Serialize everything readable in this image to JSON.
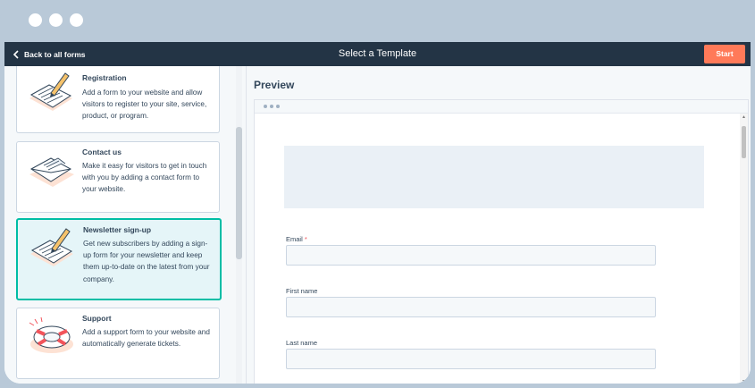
{
  "header": {
    "back_label": "Back to all forms",
    "title": "Select a Template",
    "start_label": "Start"
  },
  "templates": [
    {
      "title": "Registration",
      "desc": "Add a form to your website and allow visitors to register to your site, service, product, or program.",
      "icon": "pen-form-icon"
    },
    {
      "title": "Contact us",
      "desc": "Make it easy for visitors to get in touch with you by adding a contact form to your website.",
      "icon": "envelope-icon"
    },
    {
      "title": "Newsletter sign-up",
      "desc": "Get new subscribers by adding a sign-up form for your newsletter and keep them up-to-date on the latest from your company.",
      "icon": "pen-form-icon",
      "selected": true
    },
    {
      "title": "Support",
      "desc": "Add a support form to your website and automatically generate tickets.",
      "icon": "lifebuoy-icon"
    }
  ],
  "preview": {
    "title": "Preview",
    "fields": [
      {
        "label": "Email",
        "required_mark": "*"
      },
      {
        "label": "First name"
      },
      {
        "label": "Last name"
      }
    ]
  },
  "colors": {
    "topbar": "#233445",
    "accent": "#ff7a59",
    "selected_border": "#00bda5",
    "selected_bg": "#e5f5f8",
    "required": "#f2545b"
  }
}
